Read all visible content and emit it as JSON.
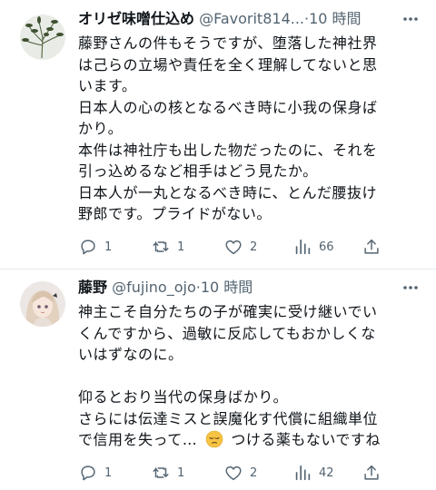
{
  "tweets": [
    {
      "author_name": "オリゼ味噌仕込め",
      "handle": "@Favorit814...",
      "separator": "·",
      "time": "10 時間",
      "lines": [
        "藤野さんの件もそうですが、堕落した神社界",
        "は己らの立場や責任を全く理解してないと思",
        "います。",
        "日本人の心の核となるべき時に小我の保身ば",
        "かり。",
        "本件は神社庁も出した物だったのに、それを",
        "引っ込めるなど相手はどう見たか。",
        "日本人が一丸となるべき時に、とんだ腰抜け",
        "野郎です。プライドがない。"
      ],
      "replies": "1",
      "retweets": "1",
      "likes": "2",
      "views": "66"
    },
    {
      "author_name": "藤野",
      "handle": "@fujino_ojo",
      "separator": "·",
      "time": "10 時間",
      "lines": [
        "神主こそ自分たちの子が確実に受け継いでい",
        "くんですから、過敏に反応してもおかしくな",
        "いはずなのに。",
        "",
        "仰るとおり当代の保身ばかり。",
        "さらには伝達ミスと誤魔化す代償に組織単位",
        "で信用を失って…",
        "つける薬もないですね"
      ],
      "emoji": "😔",
      "replies": "1",
      "retweets": "1",
      "likes": "2",
      "views": "42"
    }
  ],
  "colors": {
    "text": "#0f1419",
    "secondary": "#536471",
    "divider": "#e6e9eb"
  },
  "icons": [
    "more-icon",
    "reply-icon",
    "retweet-icon",
    "like-icon",
    "views-icon",
    "share-icon"
  ]
}
